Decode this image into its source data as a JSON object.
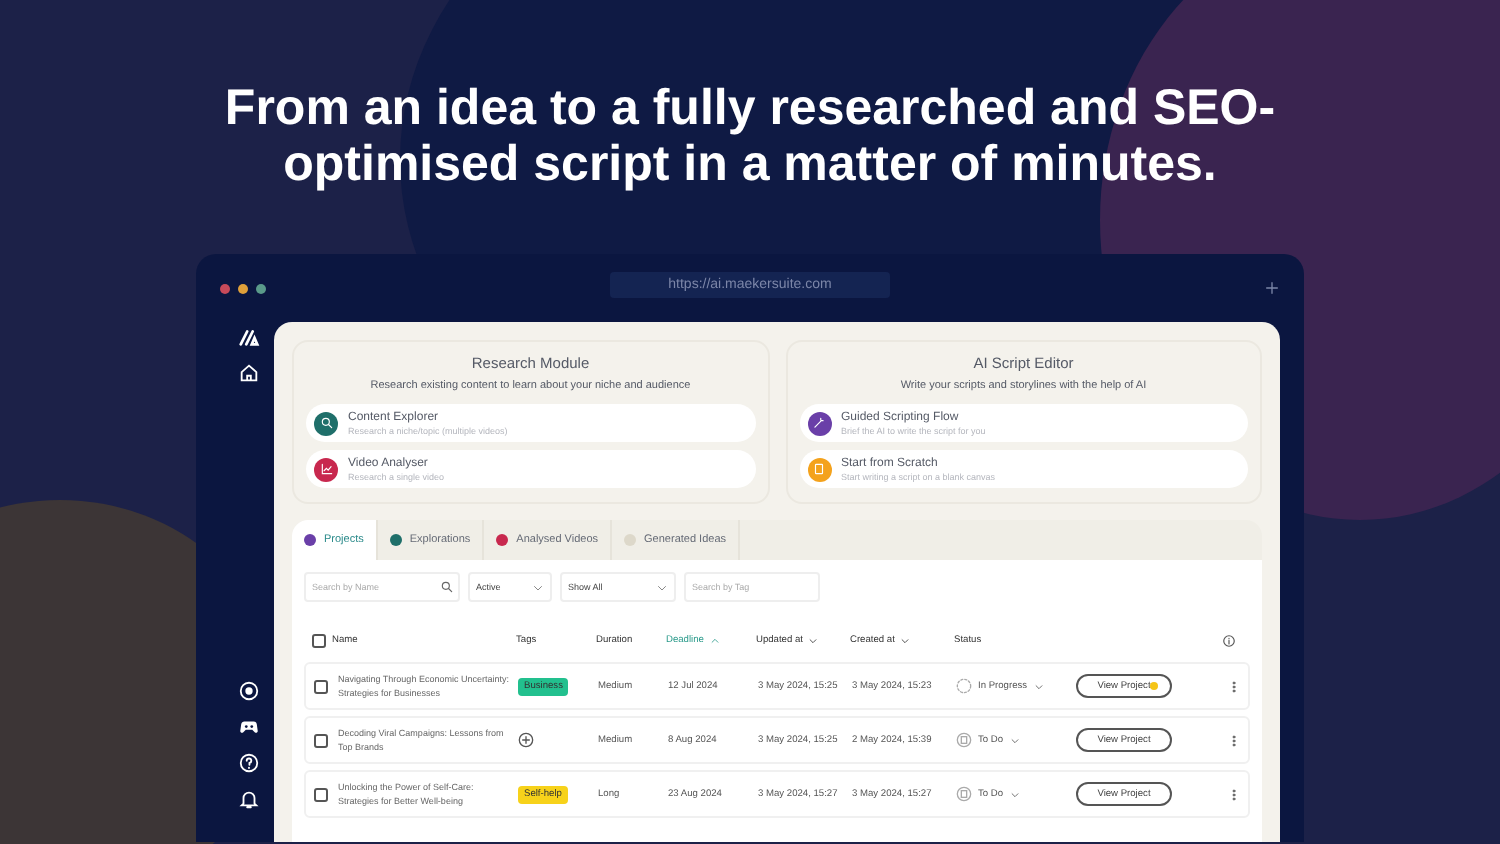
{
  "headline": "From an idea to a fully researched and SEO-optimised script in a matter of minutes.",
  "browser": {
    "url": "https://ai.maekersuite.com"
  },
  "modules": [
    {
      "title": "Research Module",
      "subtitle": "Research existing content to learn about your niche and audience",
      "items": [
        {
          "kind": "search",
          "color": "#1f6f6a",
          "title": "Content Explorer",
          "subtitle": "Research a niche/topic (multiple videos)"
        },
        {
          "kind": "chart",
          "color": "#c8284e",
          "title": "Video Analyser",
          "subtitle": "Research a single video"
        }
      ]
    },
    {
      "title": "AI Script Editor",
      "subtitle": "Write your scripts and storylines with the help of AI",
      "items": [
        {
          "kind": "wand",
          "color": "#6a3fa8",
          "title": "Guided Scripting Flow",
          "subtitle": "Brief the AI to write the script for you"
        },
        {
          "kind": "page",
          "color": "#f4a21c",
          "title": "Start from Scratch",
          "subtitle": "Start writing a script on a blank canvas"
        }
      ]
    }
  ],
  "tabs": [
    {
      "label": "Projects",
      "selected": true,
      "color": "#6a3fa8"
    },
    {
      "label": "Explorations",
      "selected": false,
      "color": "#1f6f6a"
    },
    {
      "label": "Analysed Videos",
      "selected": false,
      "color": "#c8284e"
    },
    {
      "label": "Generated Ideas",
      "selected": false,
      "color": "#ddd8ca"
    }
  ],
  "filters": {
    "search_placeholder": "Search by Name",
    "state": "Active",
    "scope": "Show All",
    "tag_placeholder": "Search by Tag"
  },
  "table": {
    "select_all_checked": false,
    "columns": [
      {
        "label": "Name",
        "sortable": false
      },
      {
        "label": "Tags",
        "sortable": false
      },
      {
        "label": "Duration",
        "sortable": false
      },
      {
        "label": "Deadline",
        "sortable": true,
        "sort_active": true,
        "ascending": true
      },
      {
        "label": "Updated at",
        "sortable": true,
        "sort_active": false,
        "ascending": false
      },
      {
        "label": "Created at",
        "sortable": true,
        "sort_active": false,
        "ascending": false
      },
      {
        "label": "Status",
        "sortable": false
      }
    ],
    "rows": [
      {
        "checked": false,
        "name": "Navigating Through Economic Uncertainty: Strategies for Businesses",
        "tag": {
          "label": "Business",
          "color": "#22c08e"
        },
        "duration": "Medium",
        "deadline": "12 Jul 2024",
        "updated": "3 May 2024, 15:25",
        "created": "3 May 2024, 15:23",
        "status": {
          "kind": "in_progress",
          "label": "In Progress"
        },
        "action": "View Project",
        "notification": true
      },
      {
        "checked": false,
        "name": "Decoding Viral Campaigns: Lessons from Top Brands",
        "tag": null,
        "duration": "Medium",
        "deadline": "8 Aug 2024",
        "updated": "3 May 2024, 15:25",
        "created": "2 May 2024, 15:39",
        "status": {
          "kind": "todo",
          "label": "To Do"
        },
        "action": "View Project",
        "notification": false
      },
      {
        "checked": false,
        "name": "Unlocking the Power of Self-Care: Strategies for Better Well-being",
        "tag": {
          "label": "Self-help",
          "color": "#f7d21a"
        },
        "duration": "Long",
        "deadline": "23 Aug 2024",
        "updated": "3 May 2024, 15:27",
        "created": "3 May 2024, 15:27",
        "status": {
          "kind": "todo",
          "label": "To Do"
        },
        "action": "View Project",
        "notification": false
      }
    ]
  }
}
